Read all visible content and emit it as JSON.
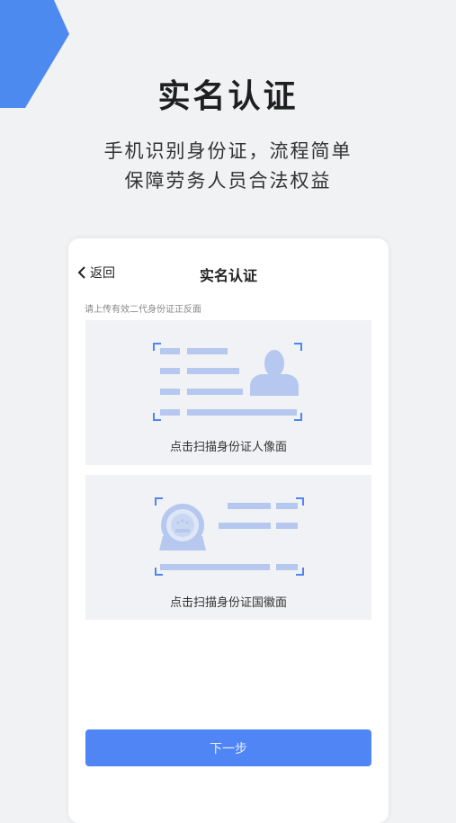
{
  "hero": {
    "title": "实名认证",
    "subtitle_line1": "手机识别身份证，流程简单",
    "subtitle_line2": "保障劳务人员合法权益"
  },
  "phone": {
    "nav": {
      "back_label": "返回",
      "title": "实名认证",
      "back_icon": "chevron-left-icon"
    },
    "hint": "请上传有效二代身份证正反面",
    "cards": [
      {
        "label": "点击扫描身份证人像面",
        "icon": "id-card-front-icon"
      },
      {
        "label": "点击扫描身份证国徽面",
        "icon": "id-card-back-icon"
      }
    ],
    "next_button": "下一步"
  },
  "colors": {
    "accent": "#4f85f5",
    "deco_blue": "#4d8af0",
    "card_bg": "#f1f2f5",
    "illustration_bar": "#b6c8ef",
    "page_bg": "#f1f2f4"
  }
}
